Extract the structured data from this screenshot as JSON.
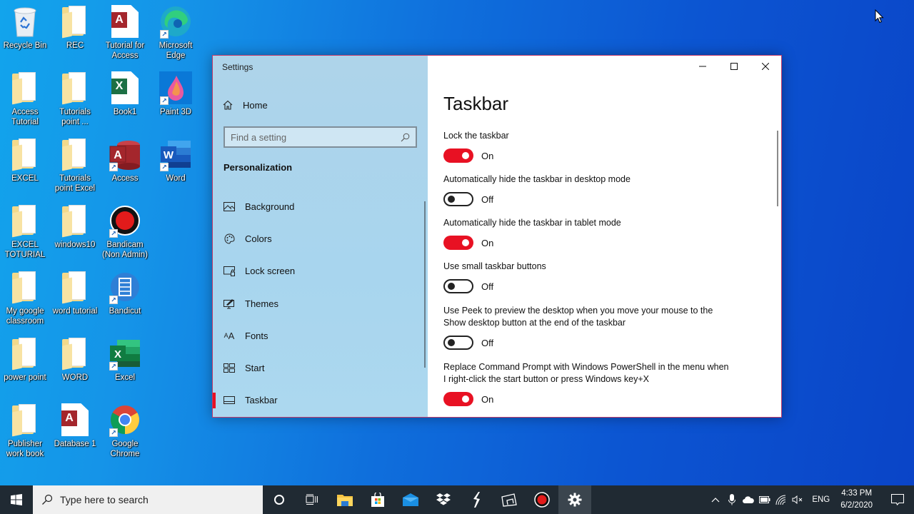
{
  "desktop": {
    "icons": [
      {
        "label": "Recycle Bin",
        "type": "recycle"
      },
      {
        "label": "REC",
        "type": "folder"
      },
      {
        "label": "Tutorial for\nAccess",
        "type": "access-doc"
      },
      {
        "label": "Microsoft\nEdge",
        "type": "edge"
      },
      {
        "label": "Access\nTutorial",
        "type": "folder"
      },
      {
        "label": "Tutorials\npoint ...",
        "type": "folder"
      },
      {
        "label": "Book1",
        "type": "excel-doc"
      },
      {
        "label": "Paint 3D",
        "type": "paint3d"
      },
      {
        "label": "EXCEL",
        "type": "folder"
      },
      {
        "label": "Tutorials\npoint Excel",
        "type": "folder"
      },
      {
        "label": "Access",
        "type": "access-app"
      },
      {
        "label": "Word",
        "type": "word-app"
      },
      {
        "label": "EXCEL\nTOTURIAL",
        "type": "folder"
      },
      {
        "label": "windows10",
        "type": "folder"
      },
      {
        "label": "Bandicam\n(Non Admin)",
        "type": "bandicam"
      },
      {
        "label": "My google\nclassroom",
        "type": "folder"
      },
      {
        "label": "word tutorial",
        "type": "folder"
      },
      {
        "label": "Bandicut",
        "type": "bandicut"
      },
      {
        "label": "power point",
        "type": "folder"
      },
      {
        "label": "WORD",
        "type": "folder"
      },
      {
        "label": "Excel",
        "type": "excel-app"
      },
      {
        "label": "Publisher\nwork book",
        "type": "folder"
      },
      {
        "label": "Database 1",
        "type": "access-doc"
      },
      {
        "label": "Google\nChrome",
        "type": "chrome"
      }
    ]
  },
  "settings": {
    "window_title": "Settings",
    "nav": {
      "home_label": "Home",
      "search_placeholder": "Find a setting",
      "section_heading": "Personalization",
      "items": [
        {
          "label": "Background",
          "icon": "image-icon"
        },
        {
          "label": "Colors",
          "icon": "palette-icon"
        },
        {
          "label": "Lock screen",
          "icon": "lock-screen-icon"
        },
        {
          "label": "Themes",
          "icon": "themes-icon"
        },
        {
          "label": "Fonts",
          "icon": "fonts-icon"
        },
        {
          "label": "Start",
          "icon": "start-icon"
        },
        {
          "label": "Taskbar",
          "icon": "taskbar-icon",
          "active": true
        }
      ]
    },
    "page_title": "Taskbar",
    "options": [
      {
        "description": "Lock the taskbar",
        "state": "On",
        "enabled": true
      },
      {
        "description": "Automatically hide the taskbar in desktop mode",
        "state": "Off",
        "enabled": false
      },
      {
        "description": "Automatically hide the taskbar in tablet mode",
        "state": "On",
        "enabled": true
      },
      {
        "description": "Use small taskbar buttons",
        "state": "Off",
        "enabled": false
      },
      {
        "description": "Use Peek to preview the desktop when you move your mouse to the Show desktop button at the end of the taskbar",
        "state": "Off",
        "enabled": false
      },
      {
        "description": "Replace Command Prompt with Windows PowerShell in the menu when I right-click the start button or press Windows key+X",
        "state": "On",
        "enabled": true
      }
    ],
    "accent_color": "#e81123"
  },
  "taskbar": {
    "search_placeholder": "Type here to search",
    "apps": [
      "cortana",
      "task-view",
      "file-explorer",
      "microsoft-store",
      "mail",
      "dropbox",
      "app-s",
      "tablet-app",
      "bandicam",
      "settings"
    ],
    "tray": {
      "language": "ENG",
      "time": "4:33 PM",
      "date": "6/2/2020"
    }
  }
}
